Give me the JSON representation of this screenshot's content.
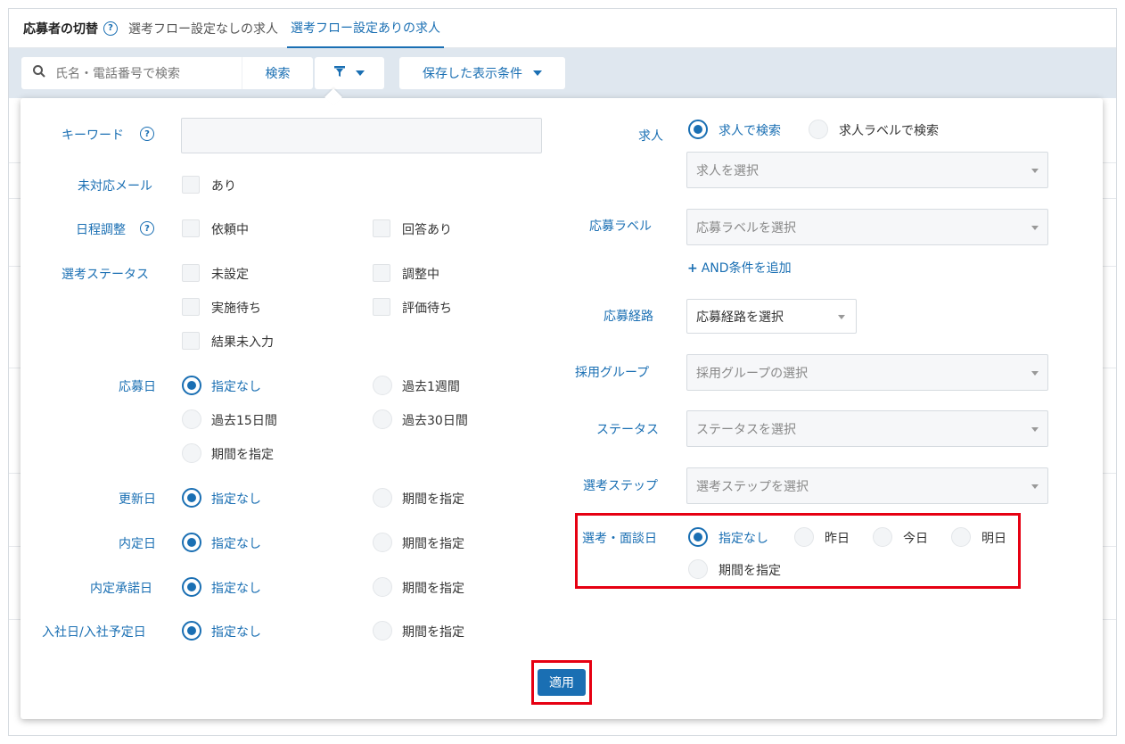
{
  "tabs": {
    "switch_label": "応募者の切替",
    "help": "?",
    "items": [
      "選考フロー設定なしの求人",
      "選考フロー設定ありの求人"
    ]
  },
  "search": {
    "placeholder": "氏名・電話番号で検索",
    "search_button": "検索",
    "saved_conditions": "保存した表示条件"
  },
  "left": {
    "keyword_label": "キーワード",
    "unhandled_mail_label": "未対応メール",
    "unhandled_mail_option": "あり",
    "schedule_label": "日程調整",
    "schedule_options": [
      "依頼中",
      "回答あり"
    ],
    "selection_status_label": "選考ステータス",
    "selection_status_options": [
      "未設定",
      "調整中",
      "実施待ち",
      "評価待ち",
      "結果未入力"
    ],
    "apply_date_label": "応募日",
    "apply_date_options": [
      "指定なし",
      "過去1週間",
      "過去15日間",
      "過去30日間",
      "期間を指定"
    ],
    "updated_label": "更新日",
    "offer_label": "内定日",
    "offer_accept_label": "内定承諾日",
    "join_label": "入社日/入社予定日",
    "none": "指定なし",
    "period": "期間を指定"
  },
  "right": {
    "job_label": "求人",
    "job_radio": [
      "求人で検索",
      "求人ラベルで検索"
    ],
    "job_select": "求人を選択",
    "apply_label_label": "応募ラベル",
    "apply_label_select": "応募ラベルを選択",
    "add_and": "AND条件を追加",
    "route_label": "応募経路",
    "route_select": "応募経路を選択",
    "group_label": "採用グループ",
    "group_select": "採用グループの選択",
    "status_label": "ステータス",
    "status_select": "ステータスを選択",
    "step_label": "選考ステップ",
    "step_select": "選考ステップを選択",
    "interview_label": "選考・面談日",
    "interview_options": [
      "指定なし",
      "昨日",
      "今日",
      "明日",
      "期間を指定"
    ]
  },
  "apply_button": "適用",
  "colors": {
    "accent": "#1a6fb3",
    "highlight": "#e60012"
  }
}
